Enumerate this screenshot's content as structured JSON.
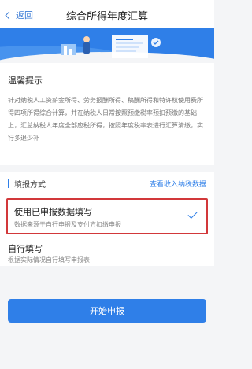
{
  "navbar": {
    "back_label": "返回",
    "title": "综合所得年度汇算"
  },
  "notice": {
    "title": "温馨提示",
    "body": "针对纳税人工资薪金所得、劳务报酬所得、稿酬所得和特许权使用费所得四项所得综合计算，并在纳税人日常按照预缴税率预扣预缴的基础上，汇总纳税人年度全部应税所得，按照年度税率表进行汇算清缴，实行多退少补"
  },
  "filing_method": {
    "section_title": "填报方式",
    "view_data_link": "查看收入纳税数据",
    "options": [
      {
        "title": "使用已申报数据填写",
        "subtitle": "数据来源于自行申报及支付方扣缴申报",
        "selected": true
      },
      {
        "title": "自行填写",
        "subtitle": "根据实际情况自行填写申报表",
        "selected": false
      }
    ]
  },
  "actions": {
    "start_label": "开始申报"
  },
  "colors": {
    "accent": "#2f7fe8",
    "highlight_border": "#d2383a"
  }
}
